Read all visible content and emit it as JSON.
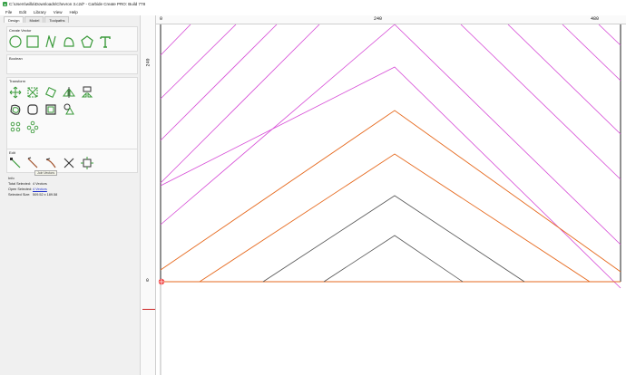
{
  "window": {
    "title": "C:\\Users\\willa\\Downloads\\Chevron 3.c2d* - Carbide Create PRO: Build 778"
  },
  "menu": [
    "File",
    "Edit",
    "Library",
    "View",
    "Help"
  ],
  "tabs": [
    "Design",
    "Model",
    "Toolpaths"
  ],
  "active_tab": "Design",
  "sections": {
    "create_vector": "Create Vector",
    "boolean": "Boolean",
    "transform": "Transform",
    "edit": "Edit",
    "info": "Info"
  },
  "tooltip": "Join Vectors",
  "info": {
    "total_selected_label": "Total Selected:",
    "total_selected_value": "4 Vectors",
    "open_selected_label": "Open Selected:",
    "open_selected_value": "4 Vectors",
    "selected_size_label": "Selected Size:",
    "selected_size_value": "509.52 x 189.58"
  },
  "rulers": {
    "h_ticks": [
      "0",
      "240",
      "480"
    ],
    "v_ticks": [
      "240",
      "0"
    ]
  },
  "colors": {
    "accent_green": "#3a9a3a",
    "magenta": "#d64bd6",
    "orange": "#e66a1f",
    "gray": "#555555"
  }
}
